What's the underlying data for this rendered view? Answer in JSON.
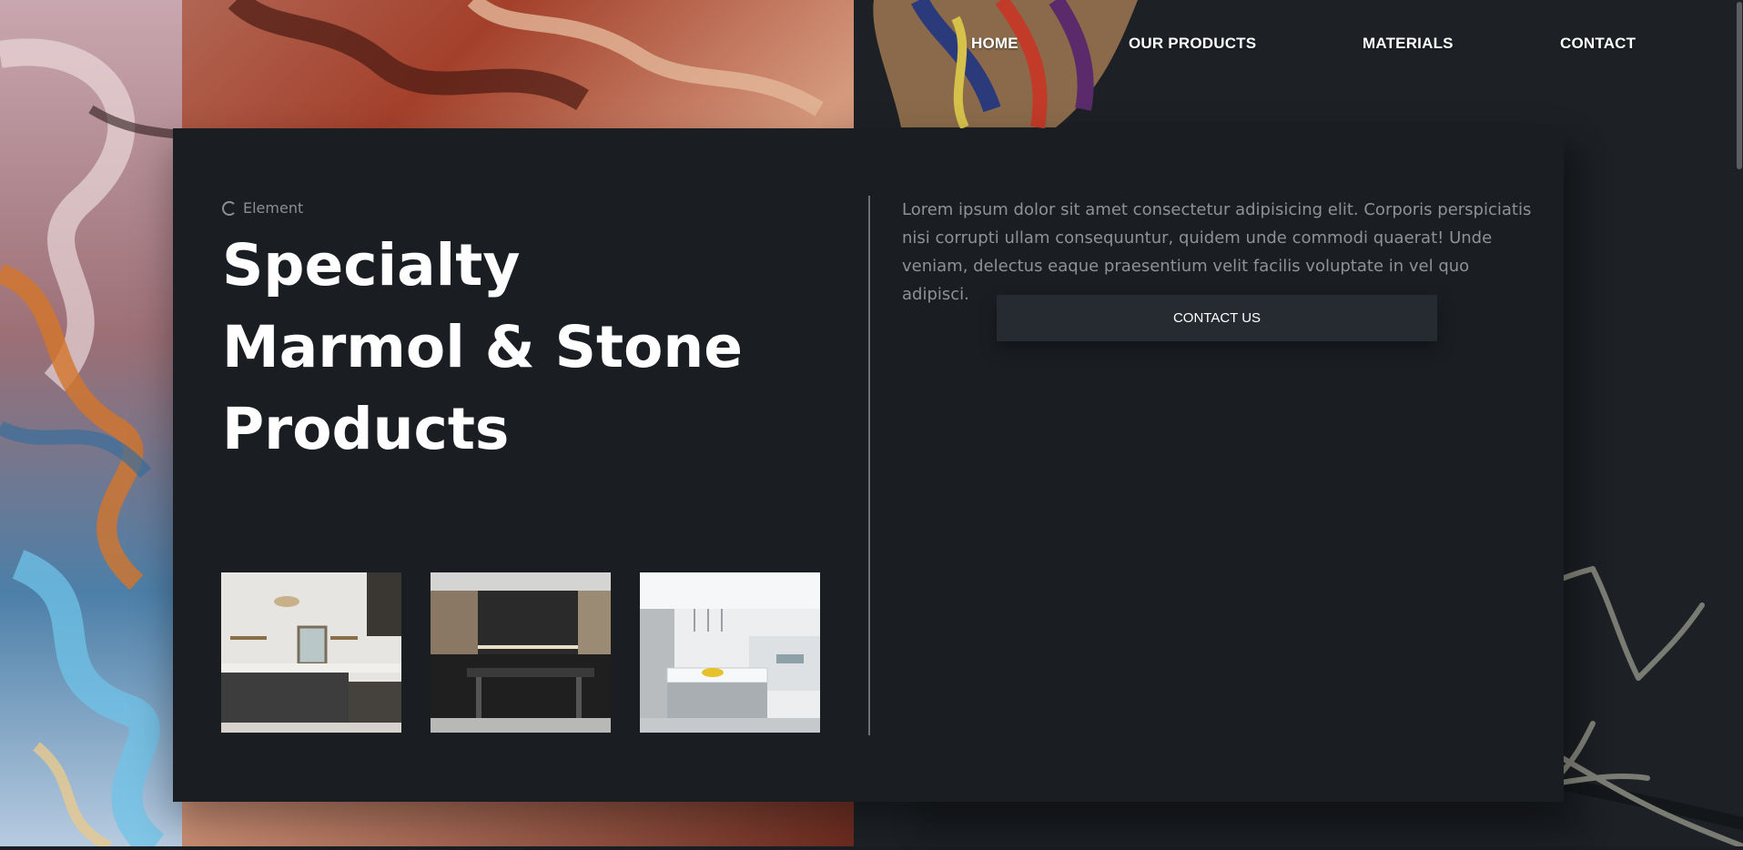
{
  "nav": {
    "home": "HOME",
    "products": "OUR PRODUCTS",
    "materials": "MATERIALS",
    "contact": "CONTACT"
  },
  "hero": {
    "eyebrow": "Element",
    "title_line1": "Specialty",
    "title_line2": "Marmol & Stone",
    "title_line3": "Products",
    "body": "Lorem ipsum dolor sit amet consectetur adipisicing elit. Corporis perspiciatis nisi corrupti ullam consequuntur, quidem unde commodi quaerat! Unde veniam, delectus eaque praesentium velit facilis voluptate in vel quo adipisci.",
    "cta": "CONTACT US"
  },
  "gallery": [
    {
      "name": "kitchen-white-dark-cabinets"
    },
    {
      "name": "kitchen-dark-island"
    },
    {
      "name": "kitchen-white-marble-island"
    }
  ],
  "colors": {
    "background": "#1b1f23",
    "card": "#1a1e22",
    "button": "#262a31",
    "text_muted": "#8e9296",
    "heading": "#ffffff"
  }
}
